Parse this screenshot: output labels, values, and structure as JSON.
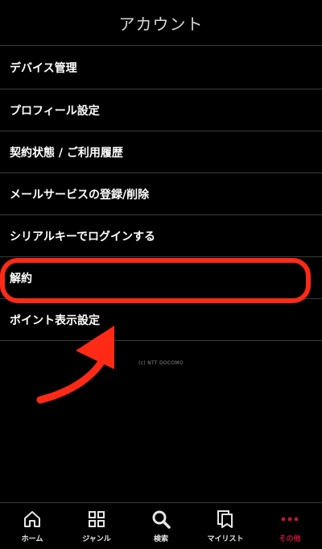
{
  "header": {
    "title": "アカウント"
  },
  "menu": {
    "items": [
      {
        "label": "デバイス管理"
      },
      {
        "label": "プロフィール設定"
      },
      {
        "label": "契約状態 / ご利用履歴"
      },
      {
        "label": "メールサービスの登録/削除"
      },
      {
        "label": "シリアルキーでログインする"
      },
      {
        "label": "解約"
      },
      {
        "label": "ポイント表示設定"
      }
    ]
  },
  "footer": {
    "copyright": "(c) NTT DOCOMO"
  },
  "annotation": {
    "highlight_color": "#ff2a16",
    "highlighted_item": "解約"
  },
  "tabbar": {
    "tabs": [
      {
        "label": "ホーム",
        "icon": "home-icon"
      },
      {
        "label": "ジャンル",
        "icon": "grid-icon"
      },
      {
        "label": "検索",
        "icon": "search-icon"
      },
      {
        "label": "マイリスト",
        "icon": "mylist-icon"
      },
      {
        "label": "その他",
        "icon": "more-dots-icon",
        "active": true
      }
    ],
    "active_color": "#c8143c"
  }
}
